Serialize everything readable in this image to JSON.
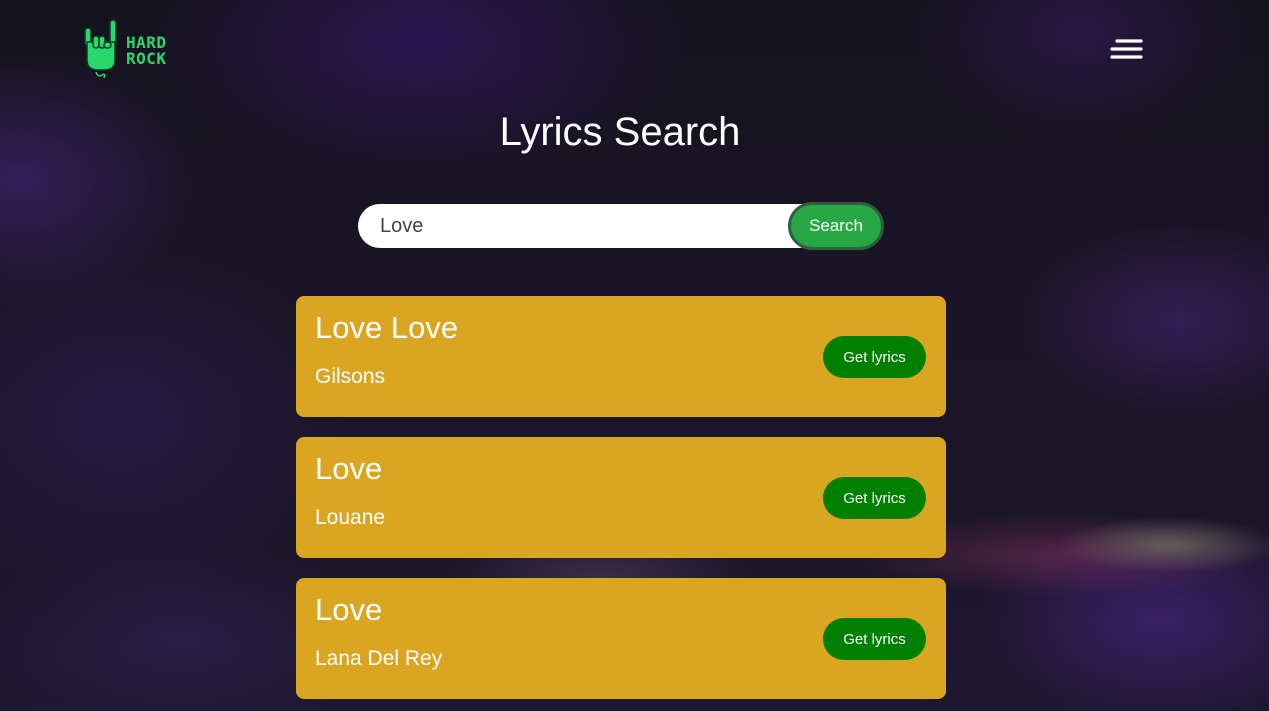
{
  "brand": {
    "logo_line1": "HARD",
    "logo_line2": "ROCK",
    "logo_icon": "rock-hand-icon",
    "accent_color": "#29d86c"
  },
  "header": {
    "menu_icon": "hamburger-menu-icon"
  },
  "page": {
    "title": "Lyrics Search"
  },
  "search": {
    "value": "Love",
    "button_label": "Search",
    "button_color": "#28a745"
  },
  "results": [
    {
      "title": "Love Love",
      "artist": "Gilsons",
      "button_label": "Get lyrics"
    },
    {
      "title": "Love",
      "artist": "Louane",
      "button_label": "Get lyrics"
    },
    {
      "title": "Love",
      "artist": "Lana Del Rey",
      "button_label": "Get lyrics"
    }
  ],
  "colors": {
    "card": "#daa520",
    "lyrics_button": "#008000"
  }
}
